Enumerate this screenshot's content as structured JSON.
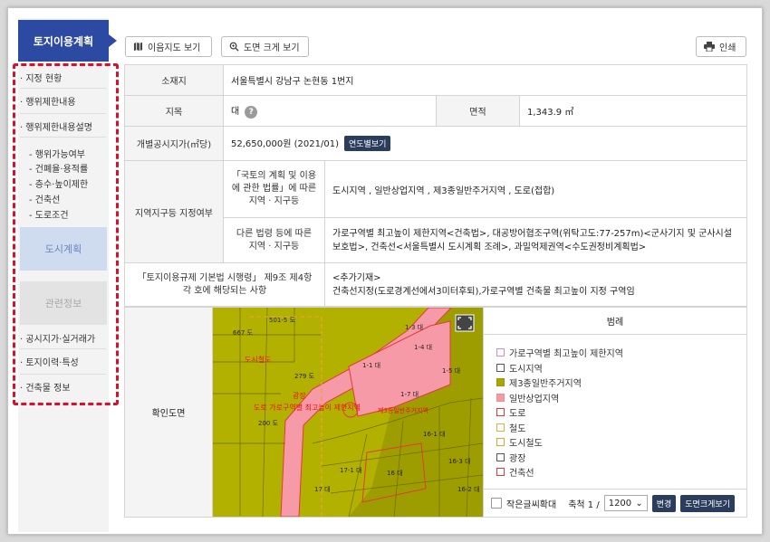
{
  "sidebar": {
    "title": "토지이용계획",
    "items": [
      "· 지정 현황",
      "· 행위제한내용",
      "· 행위제한내용설명"
    ],
    "subitems": [
      "- 행위가능여부",
      "- 건폐율·용적률",
      "- 층수·높이제한",
      "- 건축선",
      "- 도로조건"
    ],
    "city_plan": "도시계획",
    "related": "관련정보",
    "links": [
      "· 공시지가·실거래가",
      "· 토지이력·특성",
      "· 건축물 정보"
    ]
  },
  "toolbar": {
    "map_view": "이음지도 보기",
    "zoom_view": "도면 크게 보기",
    "print": "인쇄"
  },
  "info": {
    "location_label": "소재지",
    "location": "서울특별시 강남구 논현동 1번지",
    "jimok_label": "지목",
    "jimok": "대",
    "area_label": "면적",
    "area": "1,343.9 ㎡",
    "price_label": "개별공시지가(㎡당)",
    "price": "52,650,000원 (2021/01)",
    "yearly_btn": "연도별보기",
    "zone_label": "지역지구등 지정여부",
    "law1_label": "「국토의 계획 및 이용에 관한 법률」에 따른 지역 · 지구등",
    "law1": "도시지역 , 일반상업지역 , 제3종일반주거지역 , 도로(접합)",
    "law2_label": "다른 법령 등에 따른 지역 · 지구등",
    "law2": "가로구역별 최고높이 제한지역<건축법>, 대공방어협조구역(위탁고도:77-257m)<군사기지 및 군사시설 보호법>, 건축선<서울특별시 도시계획 조례>, 과밀억제권역<수도권정비계획법>",
    "reg_label": "「토지이용규제 기본법 시행령」 제9조 제4항 각 호에 해당되는 사항",
    "reg_head": "<추가기재>",
    "reg": "건축선지정(도로경계선에서3미터후퇴),가로구역별 건축물 최고높이 지정 구역임"
  },
  "map": {
    "label": "확인도면",
    "lots": [
      "667 도",
      "501-5 도",
      "1-3 대",
      "1-4 대",
      "도시철도",
      "279 도",
      "1-1 대",
      "1-5 대",
      "광장",
      "1-7 대",
      "도로  가로구역별 최고높이 제한지역",
      "제3종일반주거지역",
      "200 도",
      "16-1 대",
      "17-1 대",
      "16 대",
      "17 대",
      "16-3 대",
      "16-2 대"
    ],
    "legend_title": "범례",
    "legend": [
      {
        "label": "가로구역별 최고높이 제한지역",
        "color": "#d98ad4",
        "fill": "#ffffff"
      },
      {
        "label": "도시지역",
        "color": "#555555",
        "fill": "#ffffff"
      },
      {
        "label": "제3종일반주거지역",
        "color": "#9a9700",
        "fill": "#a9a800"
      },
      {
        "label": "일반상업지역",
        "color": "#f08d9a",
        "fill": "#f59aa6"
      },
      {
        "label": "도로",
        "color": "#e23a3a",
        "fill": "#ffffff"
      },
      {
        "label": "철도",
        "color": "#e2b040",
        "fill": "#ffffff"
      },
      {
        "label": "도시철도",
        "color": "#e2a53a",
        "fill": "#ffffff"
      },
      {
        "label": "광장",
        "color": "#555555",
        "fill": "#ffffff"
      },
      {
        "label": "건축선",
        "color": "#e23a3a",
        "fill": "#ffffff"
      }
    ],
    "small_text": "작은글씨확대",
    "scale_label": "축척 1 /",
    "scale": "1200",
    "change_btn": "변경",
    "big_btn": "도면크게보기"
  }
}
